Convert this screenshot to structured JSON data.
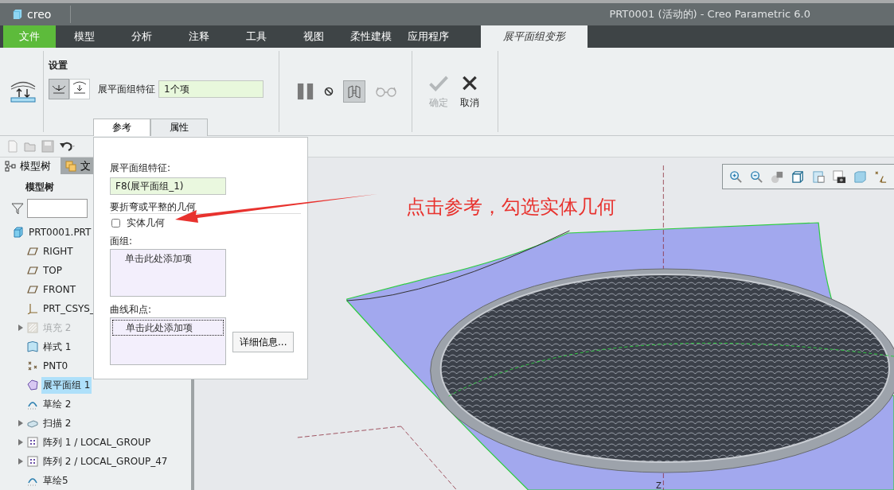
{
  "window": {
    "logo": "creo",
    "title": "PRT0001 (活动的) - Creo Parametric 6.0"
  },
  "menu_tabs": [
    {
      "label": "文件",
      "kind": "file",
      "selected": false
    },
    {
      "label": "模型",
      "kind": "normal",
      "selected": false
    },
    {
      "label": "分析",
      "kind": "normal",
      "selected": false
    },
    {
      "label": "注释",
      "kind": "normal",
      "selected": false
    },
    {
      "label": "工具",
      "kind": "normal",
      "selected": false
    },
    {
      "label": "视图",
      "kind": "normal",
      "selected": false
    },
    {
      "label": "柔性建模",
      "kind": "normal",
      "selected": false
    },
    {
      "label": "应用程序",
      "kind": "normal",
      "selected": false
    },
    {
      "label": "展平面组变形",
      "kind": "context",
      "selected": true
    }
  ],
  "ribbon": {
    "group_title": "设置",
    "direction_buttons": [
      {
        "selected": true
      },
      {
        "selected": false
      }
    ],
    "field_label": "展平面组特征",
    "field_value": "1个项",
    "preview_toggle": {
      "selected": true
    },
    "confirm": {
      "label": "确定",
      "disabled": true
    },
    "cancel": {
      "label": "取消",
      "disabled": false
    },
    "panel_tabs": [
      {
        "label": "参考",
        "selected": true
      },
      {
        "label": "属性",
        "selected": false
      }
    ]
  },
  "left_panel": {
    "tabs": [
      {
        "label": "模型树",
        "selected": true
      },
      {
        "label": "文",
        "selected": false
      }
    ],
    "heading": "模型树",
    "tree": [
      {
        "label": "PRT0001.PRT",
        "kind": "part",
        "expandable": false,
        "disabled": false,
        "selected": false,
        "children": [
          {
            "label": "RIGHT",
            "kind": "plane",
            "expandable": false,
            "disabled": false,
            "selected": false
          },
          {
            "label": "TOP",
            "kind": "plane",
            "expandable": false,
            "disabled": false,
            "selected": false
          },
          {
            "label": "FRONT",
            "kind": "plane",
            "expandable": false,
            "disabled": false,
            "selected": false
          },
          {
            "label": "PRT_CSYS_",
            "kind": "csys",
            "expandable": false,
            "disabled": false,
            "selected": false
          },
          {
            "label": "填充 2",
            "kind": "fill",
            "expandable": true,
            "disabled": true,
            "selected": false
          },
          {
            "label": "样式 1",
            "kind": "style",
            "expandable": false,
            "disabled": false,
            "selected": false
          },
          {
            "label": "PNT0",
            "kind": "point",
            "expandable": false,
            "disabled": false,
            "selected": false
          },
          {
            "label": "展平面组 1",
            "kind": "flatten",
            "expandable": false,
            "disabled": false,
            "selected": true
          },
          {
            "label": "草绘 2",
            "kind": "sketch",
            "expandable": false,
            "disabled": false,
            "selected": false
          },
          {
            "label": "扫描 2",
            "kind": "sweep",
            "expandable": true,
            "disabled": false,
            "selected": false
          },
          {
            "label": "阵列 1 / LOCAL_GROUP",
            "kind": "pattern",
            "expandable": true,
            "disabled": false,
            "selected": false
          },
          {
            "label": "阵列 2 / LOCAL_GROUP_47",
            "kind": "pattern",
            "expandable": true,
            "disabled": false,
            "selected": false
          },
          {
            "label": "草绘5",
            "kind": "sketch",
            "expandable": false,
            "disabled": false,
            "selected": false
          }
        ]
      }
    ]
  },
  "reference_panel": {
    "feature_label": "展平面组特征:",
    "feature_value": "F8(展平面组_1)",
    "geometry_label": "要折弯或平整的几何",
    "solid_checkbox": {
      "label": "实体几何",
      "checked": false
    },
    "quilts_label": "面组:",
    "quilts_placeholder": "单击此处添加项",
    "curves_label": "曲线和点:",
    "curves_placeholder": "单击此处添加项",
    "details_button": "详细信息..."
  },
  "viewport": {
    "axis_label": "Z"
  },
  "annotation": {
    "text": "点击参考，勾选实体几何"
  }
}
